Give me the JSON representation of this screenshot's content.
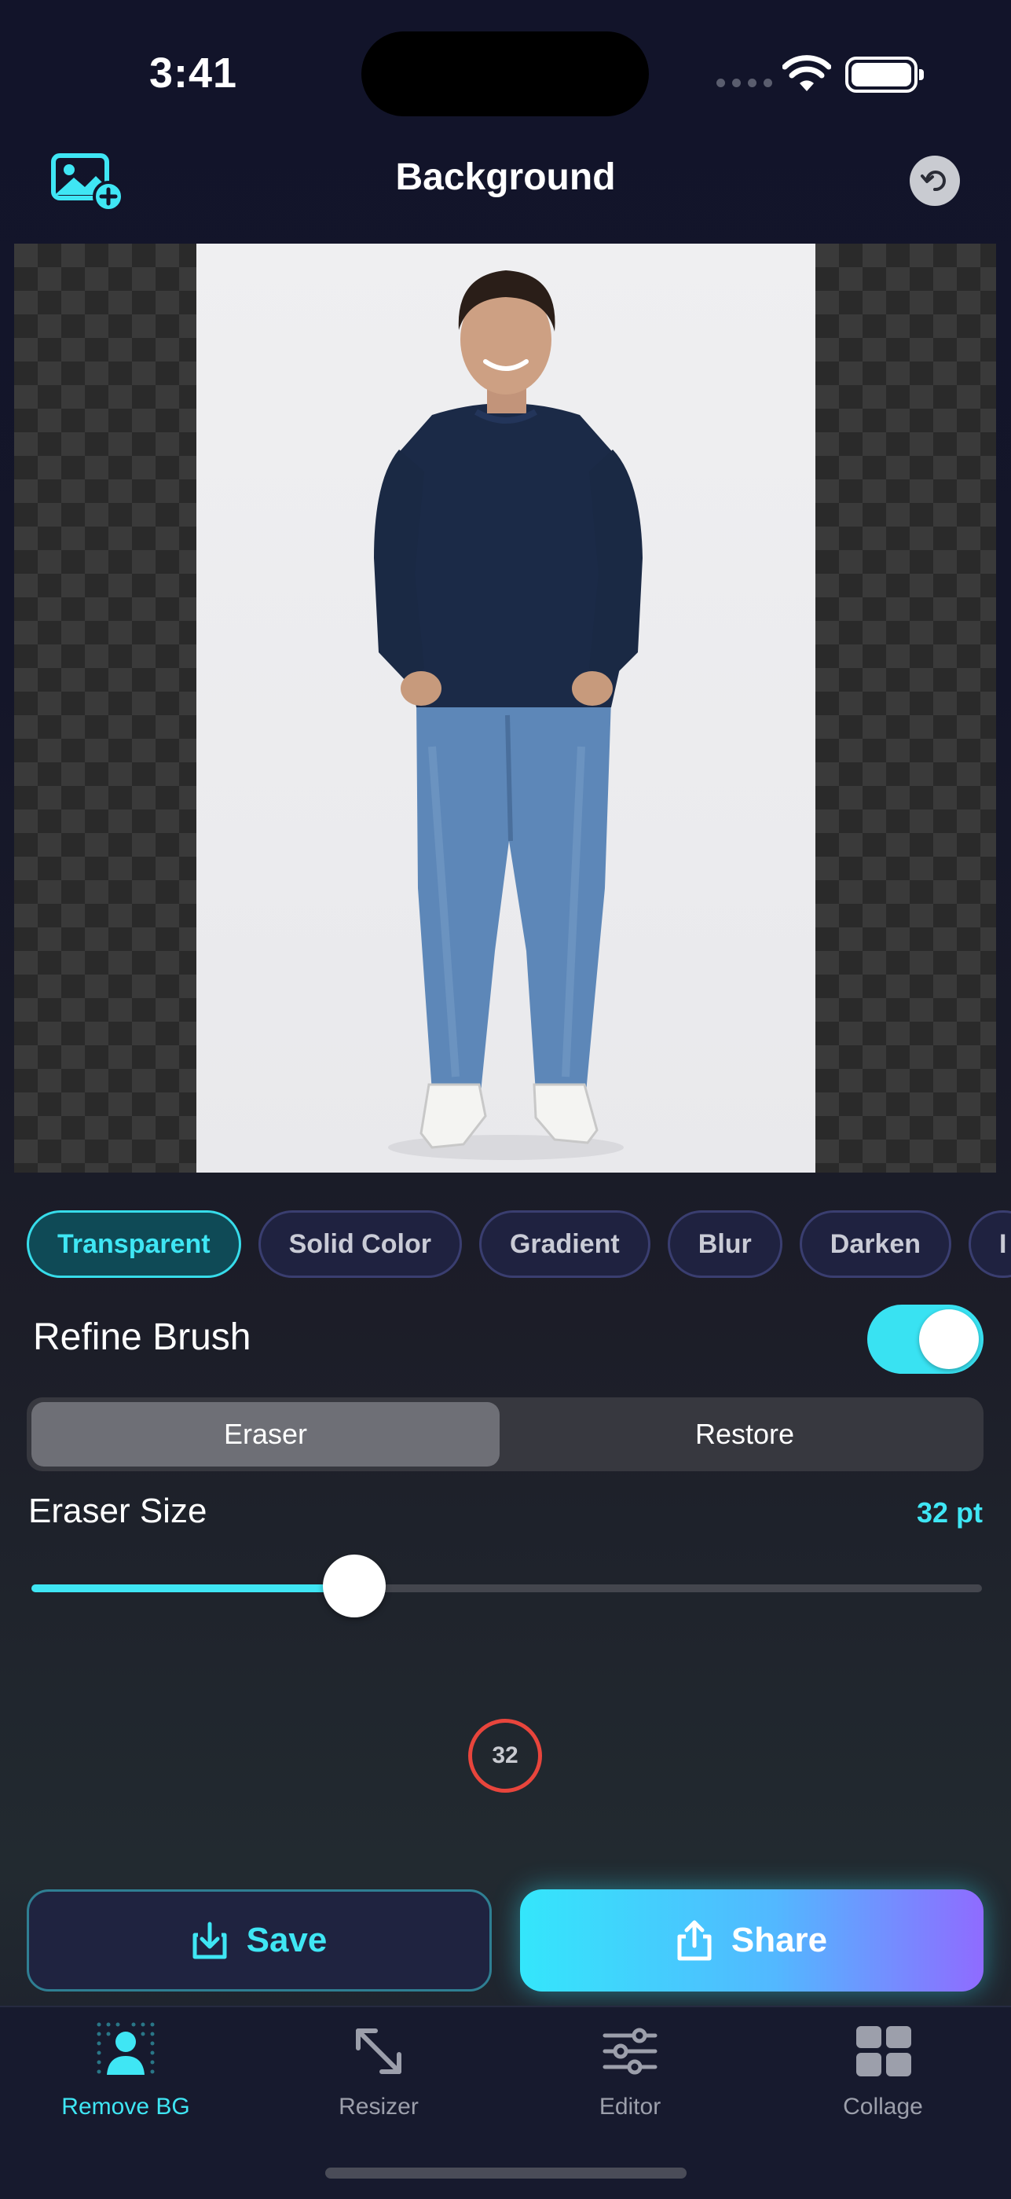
{
  "status_bar": {
    "time": "3:41"
  },
  "header": {
    "title": "Background"
  },
  "background_options": [
    "Transparent",
    "Solid Color",
    "Gradient",
    "Blur",
    "Darken",
    "I"
  ],
  "selected_background": "Transparent",
  "refine_brush": {
    "label": "Refine Brush",
    "enabled": true
  },
  "brush_mode": {
    "options": [
      "Eraser",
      "Restore"
    ],
    "selected": "Eraser"
  },
  "eraser_size": {
    "label": "Eraser Size",
    "value_text": "32 pt",
    "slider_fraction": 0.34,
    "preview_value": "32"
  },
  "actions": {
    "save_label": "Save",
    "share_label": "Share"
  },
  "tabs": [
    {
      "label": "Remove BG",
      "icon": "person-remove-bg-icon",
      "active": true
    },
    {
      "label": "Resizer",
      "icon": "resize-arrows-icon",
      "active": false
    },
    {
      "label": "Editor",
      "icon": "sliders-icon",
      "active": false
    },
    {
      "label": "Collage",
      "icon": "grid-icon",
      "active": false
    }
  ],
  "colors": {
    "accent": "#3fe6f4",
    "brush_preview": "#e8453c",
    "share_gradient_end": "#8f6bff"
  }
}
